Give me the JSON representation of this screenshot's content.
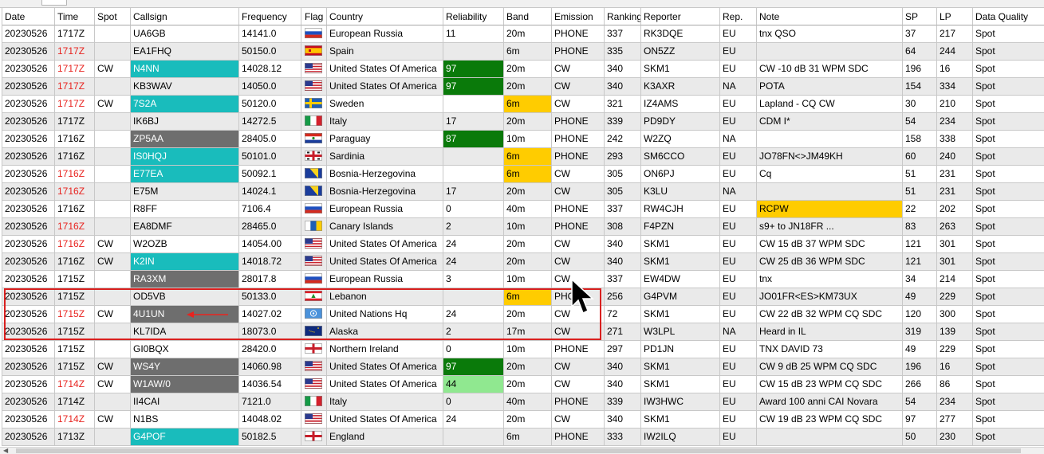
{
  "columns": [
    "Date",
    "Time",
    "Spot",
    "Callsign",
    "Frequency",
    "Flag",
    "Country",
    "Reliability",
    "Band",
    "Emission",
    "Ranking",
    "Reporter",
    "Rep.",
    "Note",
    "SP",
    "LP",
    "Data Quality"
  ],
  "colors": {
    "time_red": "#e8231f",
    "callsign_teal": "#19bcbc",
    "callsign_gray": "#6e6e6e",
    "reliability_dark_green": "#0a7a0a",
    "reliability_light_green": "#90e890",
    "band_yellow": "#ffcc00",
    "note_yellow": "#ffcc00",
    "highlight_box": "#d9201f"
  },
  "icons": {
    "pointer": "mouse-cursor-icon",
    "annotation": "red-arrow-icon",
    "scroll_left": "chevron-left-icon"
  },
  "rows": [
    {
      "date": "20230526",
      "time": "1717Z",
      "time_red": false,
      "spot": "",
      "callsign": "UA6GB",
      "callsign_bg": "",
      "frequency": "14141.0",
      "flag": "russia",
      "country": "European Russia",
      "reliability": "11",
      "rel_bg": "",
      "band": "20m",
      "band_bg": "",
      "emission": "PHONE",
      "ranking": "337",
      "reporter": "RK3DQE",
      "rep": "EU",
      "note": "tnx QSO",
      "note_bg": "",
      "sp": "37",
      "lp": "217",
      "dq": "Spot"
    },
    {
      "date": "20230526",
      "time": "1717Z",
      "time_red": true,
      "spot": "",
      "callsign": "EA1FHQ",
      "callsign_bg": "",
      "frequency": "50150.0",
      "flag": "spain",
      "country": "Spain",
      "reliability": "",
      "rel_bg": "",
      "band": "6m",
      "band_bg": "",
      "emission": "PHONE",
      "ranking": "335",
      "reporter": "ON5ZZ",
      "rep": "EU",
      "note": "",
      "note_bg": "",
      "sp": "64",
      "lp": "244",
      "dq": "Spot"
    },
    {
      "date": "20230526",
      "time": "1717Z",
      "time_red": true,
      "spot": "CW",
      "callsign": "N4NN",
      "callsign_bg": "teal",
      "frequency": "14028.12",
      "flag": "usa",
      "country": "United States Of America",
      "reliability": "97",
      "rel_bg": "dark",
      "band": "20m",
      "band_bg": "",
      "emission": "CW",
      "ranking": "340",
      "reporter": "SKM1",
      "rep": "EU",
      "note": "CW  -10 dB 31 WPM  SDC",
      "note_bg": "",
      "sp": "196",
      "lp": "16",
      "dq": "Spot"
    },
    {
      "date": "20230526",
      "time": "1717Z",
      "time_red": true,
      "spot": "",
      "callsign": "KB3WAV",
      "callsign_bg": "",
      "frequency": "14050.0",
      "flag": "usa",
      "country": "United States Of America",
      "reliability": "97",
      "rel_bg": "dark",
      "band": "20m",
      "band_bg": "",
      "emission": "CW",
      "ranking": "340",
      "reporter": "K3AXR",
      "rep": "NA",
      "note": "POTA",
      "note_bg": "",
      "sp": "154",
      "lp": "334",
      "dq": "Spot"
    },
    {
      "date": "20230526",
      "time": "1717Z",
      "time_red": true,
      "spot": "CW",
      "callsign": "7S2A",
      "callsign_bg": "teal",
      "frequency": "50120.0",
      "flag": "sweden",
      "country": "Sweden",
      "reliability": "",
      "rel_bg": "",
      "band": "6m",
      "band_bg": "yellow",
      "emission": "CW",
      "ranking": "321",
      "reporter": "IZ4AMS",
      "rep": "EU",
      "note": "Lapland - CQ CW",
      "note_bg": "",
      "sp": "30",
      "lp": "210",
      "dq": "Spot"
    },
    {
      "date": "20230526",
      "time": "1717Z",
      "time_red": false,
      "spot": "",
      "callsign": "IK6BJ",
      "callsign_bg": "",
      "frequency": "14272.5",
      "flag": "italy",
      "country": "Italy",
      "reliability": "17",
      "rel_bg": "",
      "band": "20m",
      "band_bg": "",
      "emission": "PHONE",
      "ranking": "339",
      "reporter": "PD9DY",
      "rep": "EU",
      "note": "CDM I*",
      "note_bg": "",
      "sp": "54",
      "lp": "234",
      "dq": "Spot"
    },
    {
      "date": "20230526",
      "time": "1716Z",
      "time_red": false,
      "spot": "",
      "callsign": "ZP5AA",
      "callsign_bg": "gray",
      "frequency": "28405.0",
      "flag": "paraguay",
      "country": "Paraguay",
      "reliability": "87",
      "rel_bg": "dark",
      "band": "10m",
      "band_bg": "",
      "emission": "PHONE",
      "ranking": "242",
      "reporter": "W2ZQ",
      "rep": "NA",
      "note": "",
      "note_bg": "",
      "sp": "158",
      "lp": "338",
      "dq": "Spot"
    },
    {
      "date": "20230526",
      "time": "1716Z",
      "time_red": false,
      "spot": "",
      "callsign": "IS0HQJ",
      "callsign_bg": "teal",
      "frequency": "50101.0",
      "flag": "sardinia",
      "country": "Sardinia",
      "reliability": "",
      "rel_bg": "",
      "band": "6m",
      "band_bg": "yellow",
      "emission": "PHONE",
      "ranking": "293",
      "reporter": "SM6CCO",
      "rep": "EU",
      "note": "JO78FN<>JM49KH",
      "note_bg": "",
      "sp": "60",
      "lp": "240",
      "dq": "Spot"
    },
    {
      "date": "20230526",
      "time": "1716Z",
      "time_red": true,
      "spot": "",
      "callsign": "E77EA",
      "callsign_bg": "teal",
      "frequency": "50092.1",
      "flag": "bosnia",
      "country": "Bosnia-Herzegovina",
      "reliability": "",
      "rel_bg": "",
      "band": "6m",
      "band_bg": "yellow",
      "emission": "CW",
      "ranking": "305",
      "reporter": "ON6PJ",
      "rep": "EU",
      "note": "Cq",
      "note_bg": "",
      "sp": "51",
      "lp": "231",
      "dq": "Spot"
    },
    {
      "date": "20230526",
      "time": "1716Z",
      "time_red": true,
      "spot": "",
      "callsign": "E75M",
      "callsign_bg": "",
      "frequency": "14024.1",
      "flag": "bosnia",
      "country": "Bosnia-Herzegovina",
      "reliability": "17",
      "rel_bg": "",
      "band": "20m",
      "band_bg": "",
      "emission": "CW",
      "ranking": "305",
      "reporter": "K3LU",
      "rep": "NA",
      "note": "",
      "note_bg": "",
      "sp": "51",
      "lp": "231",
      "dq": "Spot"
    },
    {
      "date": "20230526",
      "time": "1716Z",
      "time_red": false,
      "spot": "",
      "callsign": "R8FF",
      "callsign_bg": "",
      "frequency": "7106.4",
      "flag": "russia",
      "country": "European Russia",
      "reliability": "0",
      "rel_bg": "",
      "band": "40m",
      "band_bg": "",
      "emission": "PHONE",
      "ranking": "337",
      "reporter": "RW4CJH",
      "rep": "EU",
      "note": "RCPW",
      "note_bg": "yellow",
      "sp": "22",
      "lp": "202",
      "dq": "Spot"
    },
    {
      "date": "20230526",
      "time": "1716Z",
      "time_red": true,
      "spot": "",
      "callsign": "EA8DMF",
      "callsign_bg": "",
      "frequency": "28465.0",
      "flag": "canary",
      "country": "Canary Islands",
      "reliability": "2",
      "rel_bg": "",
      "band": "10m",
      "band_bg": "",
      "emission": "PHONE",
      "ranking": "308",
      "reporter": "F4PZN",
      "rep": "EU",
      "note": "s9+ to JN18FR ...",
      "note_bg": "",
      "sp": "83",
      "lp": "263",
      "dq": "Spot"
    },
    {
      "date": "20230526",
      "time": "1716Z",
      "time_red": true,
      "spot": "CW",
      "callsign": "W2OZB",
      "callsign_bg": "",
      "frequency": "14054.00",
      "flag": "usa",
      "country": "United States Of America",
      "reliability": "24",
      "rel_bg": "",
      "band": "20m",
      "band_bg": "",
      "emission": "CW",
      "ranking": "340",
      "reporter": "SKM1",
      "rep": "EU",
      "note": "CW  15 dB 37 WPM  SDC",
      "note_bg": "",
      "sp": "121",
      "lp": "301",
      "dq": "Spot"
    },
    {
      "date": "20230526",
      "time": "1716Z",
      "time_red": false,
      "spot": "CW",
      "callsign": "K2IN",
      "callsign_bg": "teal",
      "frequency": "14018.72",
      "flag": "usa",
      "country": "United States Of America",
      "reliability": "24",
      "rel_bg": "",
      "band": "20m",
      "band_bg": "",
      "emission": "CW",
      "ranking": "340",
      "reporter": "SKM1",
      "rep": "EU",
      "note": "CW  25 dB 36 WPM  SDC",
      "note_bg": "",
      "sp": "121",
      "lp": "301",
      "dq": "Spot"
    },
    {
      "date": "20230526",
      "time": "1715Z",
      "time_red": false,
      "spot": "",
      "callsign": "RA3XM",
      "callsign_bg": "gray",
      "frequency": "28017.8",
      "flag": "russia",
      "country": "European Russia",
      "reliability": "3",
      "rel_bg": "",
      "band": "10m",
      "band_bg": "",
      "emission": "CW",
      "ranking": "337",
      "reporter": "EW4DW",
      "rep": "EU",
      "note": "tnx",
      "note_bg": "",
      "sp": "34",
      "lp": "214",
      "dq": "Spot"
    },
    {
      "date": "20230526",
      "time": "1715Z",
      "time_red": false,
      "spot": "",
      "callsign": "OD5VB",
      "callsign_bg": "",
      "frequency": "50133.0",
      "flag": "lebanon",
      "country": "Lebanon",
      "reliability": "",
      "rel_bg": "",
      "band": "6m",
      "band_bg": "yellow",
      "emission": "PHO",
      "ranking": "256",
      "reporter": "G4PVM",
      "rep": "EU",
      "note": "JO01FR<ES>KM73UX",
      "note_bg": "",
      "sp": "49",
      "lp": "229",
      "dq": "Spot"
    },
    {
      "date": "20230526",
      "time": "1715Z",
      "time_red": true,
      "spot": "CW",
      "callsign": "4U1UN",
      "callsign_bg": "gray",
      "frequency": "14027.02",
      "flag": "un",
      "country": "United Nations Hq",
      "reliability": "24",
      "rel_bg": "",
      "band": "20m",
      "band_bg": "",
      "emission": "CW",
      "ranking": "72",
      "reporter": "SKM1",
      "rep": "EU",
      "note": "CW  22 dB 32 WPM  CQ  SDC",
      "note_bg": "",
      "sp": "120",
      "lp": "300",
      "dq": "Spot"
    },
    {
      "date": "20230526",
      "time": "1715Z",
      "time_red": false,
      "spot": "",
      "callsign": "KL7IDA",
      "callsign_bg": "",
      "frequency": "18073.0",
      "flag": "alaska",
      "country": "Alaska",
      "reliability": "2",
      "rel_bg": "",
      "band": "17m",
      "band_bg": "",
      "emission": "CW",
      "ranking": "271",
      "reporter": "W3LPL",
      "rep": "NA",
      "note": "Heard in IL",
      "note_bg": "",
      "sp": "319",
      "lp": "139",
      "dq": "Spot"
    },
    {
      "date": "20230526",
      "time": "1715Z",
      "time_red": false,
      "spot": "",
      "callsign": "GI0BQX",
      "callsign_bg": "",
      "frequency": "28420.0",
      "flag": "nireland",
      "country": "Northern Ireland",
      "reliability": "0",
      "rel_bg": "",
      "band": "10m",
      "band_bg": "",
      "emission": "PHONE",
      "ranking": "297",
      "reporter": "PD1JN",
      "rep": "EU",
      "note": "TNX DAVID 73",
      "note_bg": "",
      "sp": "49",
      "lp": "229",
      "dq": "Spot"
    },
    {
      "date": "20230526",
      "time": "1715Z",
      "time_red": false,
      "spot": "CW",
      "callsign": "WS4Y",
      "callsign_bg": "gray",
      "frequency": "14060.98",
      "flag": "usa",
      "country": "United States Of America",
      "reliability": "97",
      "rel_bg": "dark",
      "band": "20m",
      "band_bg": "",
      "emission": "CW",
      "ranking": "340",
      "reporter": "SKM1",
      "rep": "EU",
      "note": "CW  9 dB 25 WPM  CQ  SDC",
      "note_bg": "",
      "sp": "196",
      "lp": "16",
      "dq": "Spot"
    },
    {
      "date": "20230526",
      "time": "1714Z",
      "time_red": true,
      "spot": "CW",
      "callsign": "W1AW/0",
      "callsign_bg": "gray",
      "frequency": "14036.54",
      "flag": "usa",
      "country": "United States Of America",
      "reliability": "44",
      "rel_bg": "light",
      "band": "20m",
      "band_bg": "",
      "emission": "CW",
      "ranking": "340",
      "reporter": "SKM1",
      "rep": "EU",
      "note": "CW  15 dB 23 WPM  CQ  SDC",
      "note_bg": "",
      "sp": "266",
      "lp": "86",
      "dq": "Spot"
    },
    {
      "date": "20230526",
      "time": "1714Z",
      "time_red": false,
      "spot": "",
      "callsign": "II4CAI",
      "callsign_bg": "",
      "frequency": "7121.0",
      "flag": "italy",
      "country": "Italy",
      "reliability": "0",
      "rel_bg": "",
      "band": "40m",
      "band_bg": "",
      "emission": "PHONE",
      "ranking": "339",
      "reporter": "IW3HWC",
      "rep": "EU",
      "note": "Award 100 anni CAI Novara",
      "note_bg": "",
      "sp": "54",
      "lp": "234",
      "dq": "Spot"
    },
    {
      "date": "20230526",
      "time": "1714Z",
      "time_red": true,
      "spot": "CW",
      "callsign": "N1BS",
      "callsign_bg": "",
      "frequency": "14048.02",
      "flag": "usa",
      "country": "United States Of America",
      "reliability": "24",
      "rel_bg": "",
      "band": "20m",
      "band_bg": "",
      "emission": "CW",
      "ranking": "340",
      "reporter": "SKM1",
      "rep": "EU",
      "note": "CW  19 dB 23 WPM  CQ  SDC",
      "note_bg": "",
      "sp": "97",
      "lp": "277",
      "dq": "Spot"
    },
    {
      "date": "20230526",
      "time": "1713Z",
      "time_red": false,
      "spot": "",
      "callsign": "G4POF",
      "callsign_bg": "teal",
      "frequency": "50182.5",
      "flag": "england",
      "country": "England",
      "reliability": "",
      "rel_bg": "",
      "band": "6m",
      "band_bg": "",
      "emission": "PHONE",
      "ranking": "333",
      "reporter": "IW2ILQ",
      "rep": "EU",
      "note": "",
      "note_bg": "",
      "sp": "50",
      "lp": "230",
      "dq": "Spot"
    }
  ]
}
